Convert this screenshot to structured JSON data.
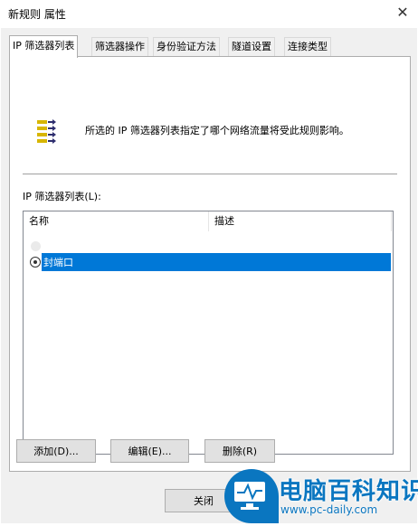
{
  "window": {
    "title": "新规则 属性",
    "close_glyph": "✕"
  },
  "tabs": [
    {
      "label": "IP 筛选器列表"
    },
    {
      "label": "筛选器操作"
    },
    {
      "label": "身份验证方法"
    },
    {
      "label": "隧道设置"
    },
    {
      "label": "连接类型"
    }
  ],
  "panel": {
    "description": "所选的 IP 筛选器列表指定了哪个网络流量将受此规则影响。",
    "list_label": "IP 筛选器列表(L):",
    "columns": [
      "名称",
      "描述"
    ],
    "rows": [
      {
        "name": "封端口",
        "description": "",
        "selected": true
      }
    ]
  },
  "buttons": {
    "add": "添加(D)...",
    "edit": "编辑(E)...",
    "remove": "删除(R)",
    "close": "关闭"
  },
  "watermark": {
    "text": "电脑百科知识",
    "url": "www.pc-daily.com"
  },
  "colors": {
    "selection": "#0078d7",
    "watermark": "#0a76c0"
  }
}
